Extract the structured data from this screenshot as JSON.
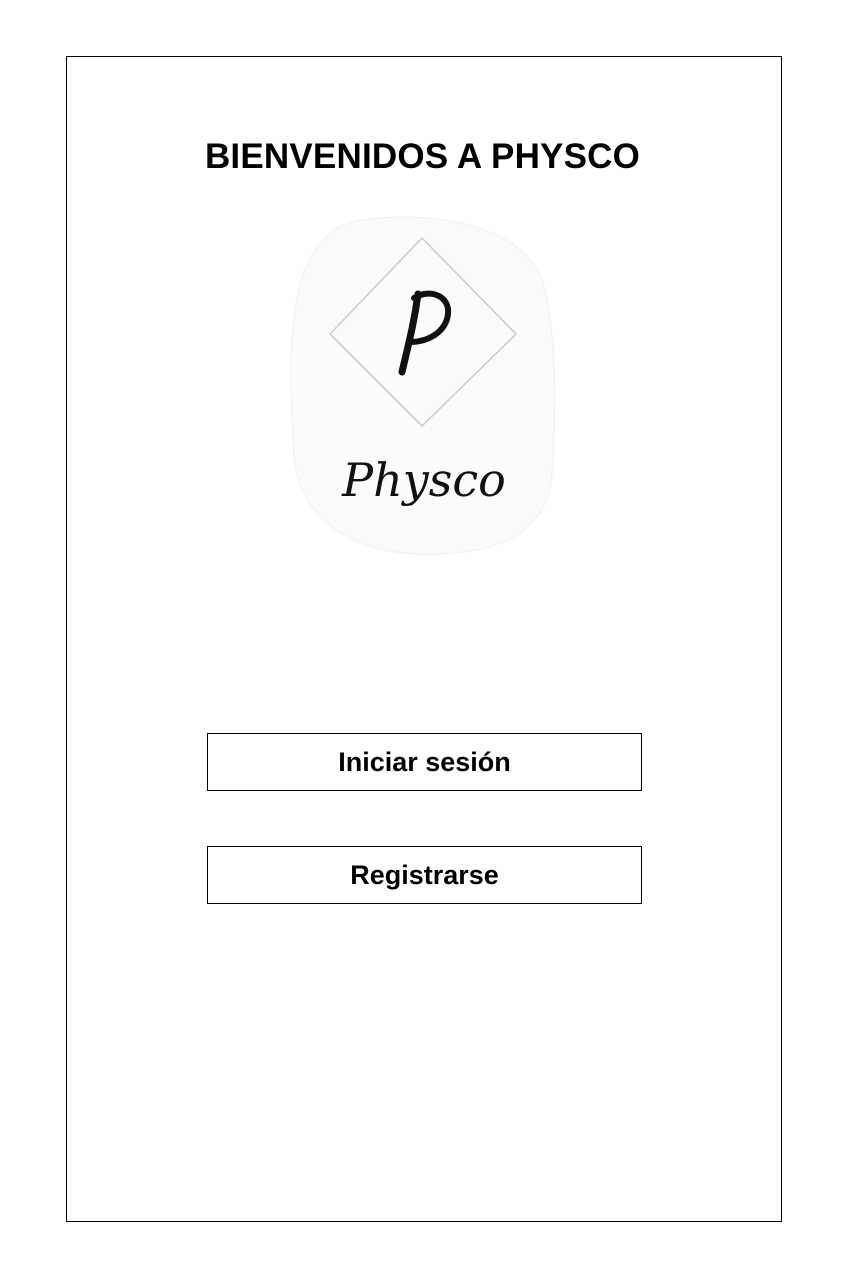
{
  "welcome": {
    "title": "BIENVENIDOS A PHYSCO"
  },
  "logo": {
    "icon": "physco-logo",
    "monogram": "P",
    "wordmark": "Physco"
  },
  "actions": {
    "login_label": "Iniciar sesión",
    "register_label": "Registrarse"
  },
  "colors": {
    "background": "#ffffff",
    "border": "#000000",
    "text": "#000000"
  }
}
